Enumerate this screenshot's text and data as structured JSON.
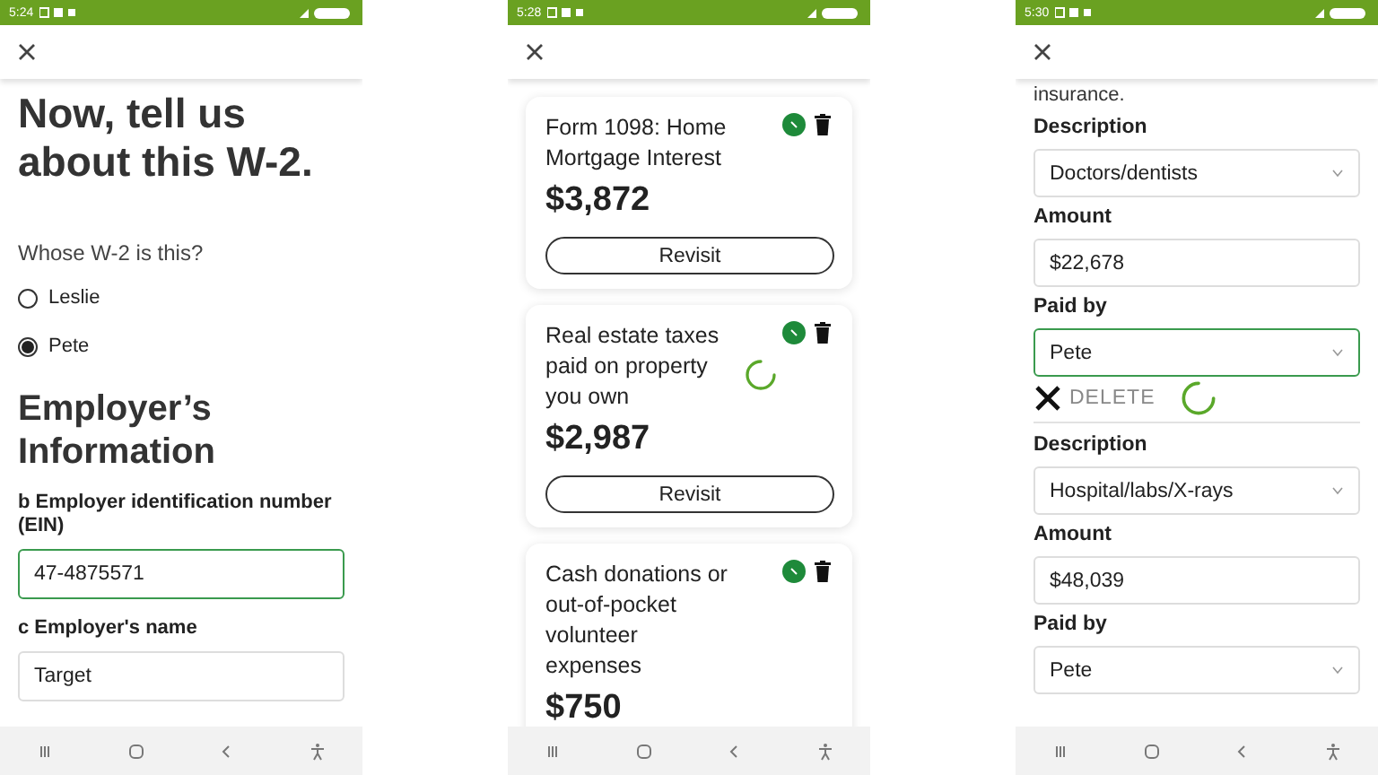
{
  "screens": [
    {
      "kind": "w2",
      "status_time": "5:24",
      "title": "Now, tell us about this W-2.",
      "question": "Whose W-2 is this?",
      "options": [
        {
          "label": "Leslie",
          "selected": false
        },
        {
          "label": "Pete",
          "selected": true
        }
      ],
      "heading": "Employer’s Information",
      "fields": [
        {
          "label": "b Employer identification number (EIN)",
          "value": "47-4875571",
          "focused": true
        },
        {
          "label": "c Employer's name",
          "value": "Target",
          "focused": false
        }
      ]
    },
    {
      "kind": "cards",
      "status_time": "5:28",
      "cards": [
        {
          "title": "Form 1098: Home Mortgage Interest",
          "amount": "$3,872",
          "button": "Revisit",
          "loading": false
        },
        {
          "title": "Real estate taxes paid on property you own",
          "amount": "$2,987",
          "button": "Revisit",
          "loading": true
        },
        {
          "title": "Cash donations or out-of-pocket volunteer expenses",
          "amount": "$750"
        }
      ]
    },
    {
      "kind": "expenses",
      "status_time": "5:30",
      "intro": "insurance.",
      "groups": [
        {
          "fields": [
            {
              "label": "Description",
              "value": "Doctors/dentists",
              "kind": "select",
              "focused": false
            },
            {
              "label": "Amount",
              "value": "$22,678",
              "kind": "text",
              "focused": false
            },
            {
              "label": "Paid by",
              "value": "Pete",
              "kind": "select",
              "focused": true
            }
          ],
          "delete": "DELETE",
          "loading": true
        },
        {
          "fields": [
            {
              "label": "Description",
              "value": "Hospital/labs/X-rays",
              "kind": "select",
              "focused": false
            },
            {
              "label": "Amount",
              "value": "$48,039",
              "kind": "text",
              "focused": false
            },
            {
              "label": "Paid by",
              "value": "Pete",
              "kind": "select",
              "focused": false
            }
          ]
        }
      ]
    }
  ]
}
